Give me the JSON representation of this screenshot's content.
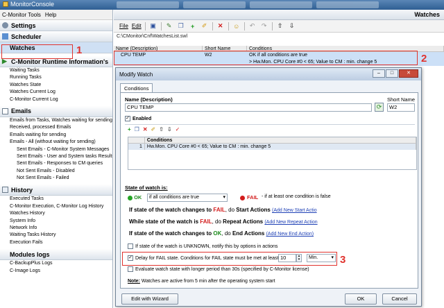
{
  "app": {
    "title": "MonitorConsole"
  },
  "left": {
    "menu": [
      "C-Monitor Tools",
      "Help"
    ],
    "sections": {
      "settings": "Settings",
      "scheduler": "Scheduler",
      "watches": "Watches",
      "runtime": "C-Monitor Runtime Information's",
      "emails": "Emails",
      "history": "History",
      "modules": "Modules logs"
    },
    "runtime_items": [
      "Waiting Tasks",
      "Running Tasks",
      "Watches State",
      "Watches Current Log",
      "C-Monitor Current Log"
    ],
    "email_items": [
      "Emails from Tasks, Watches waiting for sending",
      "Received, processed Emails",
      "Emails waiting for sending",
      "Emails - All (without waiting for sending)"
    ],
    "email_sub_items": [
      "Sent Emails - C-Monitor System Messages",
      "Sent Emails - User and System tasks Results",
      "Sent Emails - Responses to CM queries",
      "Not Sent Emails - Disabled",
      "Not Sent Emails - Failed"
    ],
    "history_items": [
      "Executed Tasks",
      "C-Monitor Execution, C-Monitor Log History",
      "Watches History",
      "System Info",
      "Network Info",
      "Waiting Tasks History",
      "Execution Fails"
    ],
    "module_items": [
      "C-BackupPlus Logs",
      "C-Image Logs"
    ]
  },
  "right": {
    "header": "Watches",
    "toolbar": {
      "file": "File",
      "edit": "Edit"
    },
    "path": "C:\\CMonitor\\Cnf\\WatchesList.swl",
    "columns": [
      "Name (Description)",
      "Short Name",
      "Conditions"
    ],
    "row": {
      "name": "CPU TEMP",
      "short": "W2",
      "cond1": "OK if all conditions are true",
      "cond2": "> Hw.Mon. CPU Core #0 < 65; Value to CM : min. change 5"
    }
  },
  "modal": {
    "title": "Modify Watch",
    "tab": "Conditions",
    "name_label": "Name (Description)",
    "name_value": "CPU TEMP",
    "short_label": "Short Name",
    "short_value": "W2",
    "enabled": "Enabled",
    "conditions_header": "Conditions",
    "condition_row_index": "1",
    "condition_row_text": "Hw.Mon. CPU Core #0 < 65; Value to CM : min. change 5",
    "state_label": "State of watch is:",
    "ok_label": "OK",
    "ok_select": "if all conditions are true",
    "fail_label": "FAIL",
    "fail_text": "- if at least one condition is false",
    "start": {
      "prefix": "If state of the watch changes to",
      "state": "FAIL",
      "suffix": ", do",
      "action": "Start Actions",
      "link": "(Add New Start Actio"
    },
    "repeat": {
      "prefix": "While state of the watch is",
      "state": "FAIL",
      "suffix": ", do",
      "action": "Repeat Actions",
      "link": "(Add New Repeat Action"
    },
    "end": {
      "prefix": "If state of the watch changes to",
      "state": "OK",
      "suffix": ", do",
      "action": "End Actions",
      "link": "(Add New End Action)"
    },
    "unknown_text": "If state of the watch is UNKNOWN, notify this by options in actions",
    "delay_text": "Delay for FAIL state. Conditions for FAIL state must be met at least",
    "delay_value": "10",
    "delay_unit": "Min.",
    "evaluate_text": "Evaluate watch state with longer period than 30s (specified by C-Monitor license)",
    "note_label": "Note:",
    "note_text": "Watches are active from 5 min after the operating system start",
    "wizard_button": "Edit with Wizard",
    "ok_button": "OK",
    "cancel_button": "Cancel"
  },
  "annotations": [
    "1",
    "2",
    "3"
  ],
  "colors": {
    "accent": "#e0322d",
    "selection": "#cce0f7",
    "fail": "#d21c1c",
    "ok": "#1c8a1c"
  }
}
